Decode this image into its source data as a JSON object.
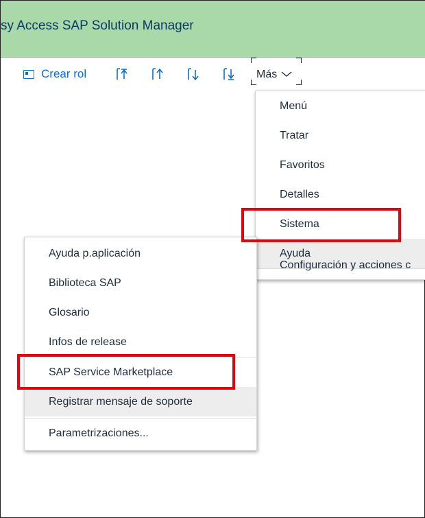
{
  "window": {
    "title": "sy Access  SAP Solution Manager"
  },
  "toolbar": {
    "create_role_label": "Crear rol",
    "more_label": "Más",
    "nav_icons": [
      "move-to-top-icon",
      "move-up-icon",
      "move-down-icon",
      "move-to-bottom-icon"
    ]
  },
  "main_menu": {
    "items": [
      {
        "label": "Menú"
      },
      {
        "label": "Tratar"
      },
      {
        "label": "Favoritos"
      },
      {
        "label": "Detalles"
      },
      {
        "label": "Sistema"
      },
      {
        "label": "Ayuda"
      },
      {
        "label": "Configuración y acciones c"
      }
    ]
  },
  "help_submenu": {
    "items": [
      {
        "label": "Ayuda p.aplicación"
      },
      {
        "label": "Biblioteca SAP"
      },
      {
        "label": "Glosario"
      },
      {
        "label": "Infos de release"
      },
      {
        "label": "SAP Service Marketplace"
      },
      {
        "label": "Registrar mensaje de soporte"
      },
      {
        "label": "Parametrizaciones..."
      }
    ]
  },
  "colors": {
    "titlebar": "#a9d9a9",
    "link_blue": "#0a6ed1",
    "highlight_red": "#e8000a",
    "hover_gray": "#ededed"
  }
}
